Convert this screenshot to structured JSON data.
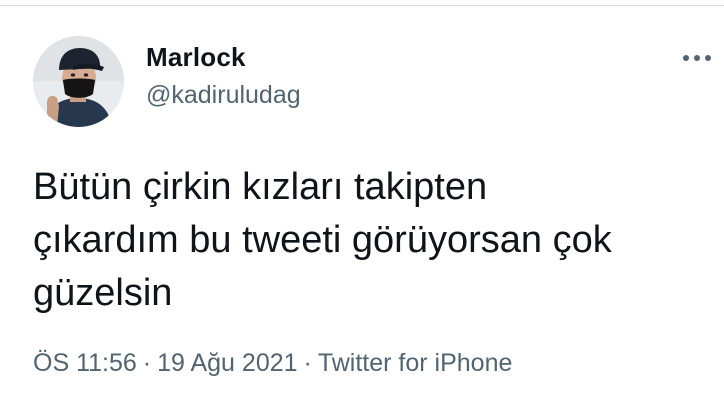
{
  "tweet": {
    "author": {
      "display_name": "Marlock",
      "handle": "@kadiruludag",
      "avatar_icon": "profile-avatar"
    },
    "text": "Bütün çirkin kızları takipten\nçıkardım bu tweeti görüyorsan çok\ngüzelsin",
    "time": "ÖS 11:56",
    "separator": "·",
    "date": "19 Ağu 2021",
    "source": "Twitter for iPhone",
    "more_icon": "more-options-icon"
  },
  "colors": {
    "text_primary": "#0f1419",
    "text_secondary": "#536471",
    "border": "#d6dde3"
  }
}
